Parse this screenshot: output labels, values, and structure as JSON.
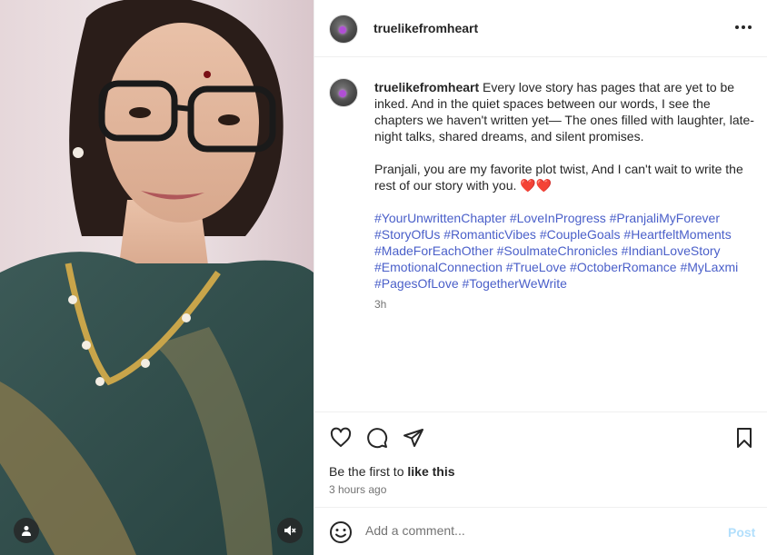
{
  "post": {
    "username": "truelikefromheart",
    "caption_p1": " Every love story has pages that are yet to be inked. And in the quiet spaces between our words, I see the chapters we haven't written yet— The ones filled with laughter, late-night talks, shared dreams, and silent promises.",
    "caption_p2": "Pranjali, you are my favorite plot twist, And I can't wait to write the rest of our story with you. ❤️❤️",
    "hashtags": "#YourUnwrittenChapter #LoveInProgress #PranjaliMyForever #StoryOfUs #RomanticVibes #CoupleGoals #HeartfeltMoments #MadeForEachOther #SoulmateChronicles #IndianLoveStory #EmotionalConnection #TrueLove #OctoberRomance #MyLaxmi #PagesOfLove #TogetherWeWrite",
    "relative_time": "3h"
  },
  "likes": {
    "prefix": "Be the first to ",
    "link": "like this"
  },
  "timestamp": "3 hours ago",
  "comment": {
    "placeholder": "Add a comment...",
    "post_label": "Post"
  },
  "icons": [
    "user-icon",
    "mute-icon",
    "more-icon",
    "heart-icon",
    "comment-icon",
    "share-icon",
    "bookmark-icon",
    "emoji-icon"
  ],
  "colors": {
    "hashtag": "#4a5fc9",
    "muted": "#737373",
    "post_disabled": "#b2dffc"
  }
}
